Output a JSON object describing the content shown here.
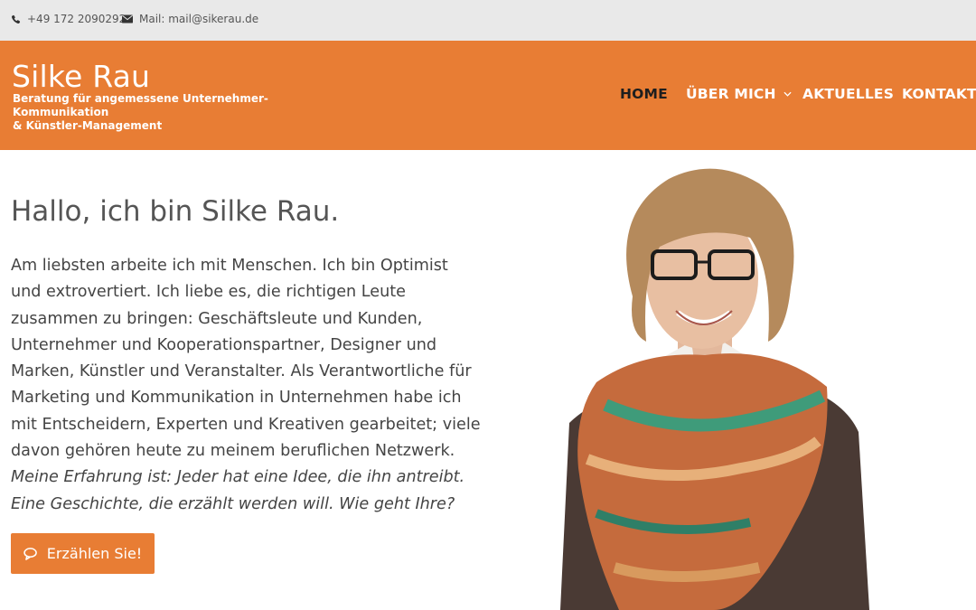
{
  "topbar": {
    "phone": "+49 172 2090292",
    "mail": "Mail: mail@sikerau.de"
  },
  "header": {
    "title": "Silke Rau",
    "subtitle_line1": "Beratung für angemessene Unternehmer-Kommunikation",
    "subtitle_line2": "& Künstler-Management",
    "brand_color": "#e87d34"
  },
  "nav": {
    "home": "HOME",
    "about": "ÜBER MICH",
    "news": "AKTUELLES",
    "contact": "KONTAKT"
  },
  "main": {
    "heading": "Hallo, ich bin Silke Rau.",
    "paragraph": "Am liebsten arbeite ich mit Menschen. Ich bin Optimist und extrovertiert. Ich liebe es, die richtigen Leute zusammen zu bringen: Geschäftsleute und Kunden, Unternehmer und Kooperationspartner, Designer und Marken, Künstler und Veranstalter. Als Verantwortliche für Marketing und Kommunikation in Unternehmen habe ich mit Entscheidern, Experten und Kreativen gearbeitet; viele davon gehören heute zu meinem beruflichen Netzwerk.",
    "paragraph_italic": "Meine Erfahrung ist: Jeder hat eine Idee, die ihn antreibt. Eine Geschichte, die erzählt werden will. Wie geht Ihre?",
    "cta_label": "Erzählen Sie!"
  },
  "icons": {
    "phone": "phone-icon",
    "mail": "envelope-icon",
    "chevron": "chevron-down-icon",
    "chat": "chat-bubble-icon"
  }
}
